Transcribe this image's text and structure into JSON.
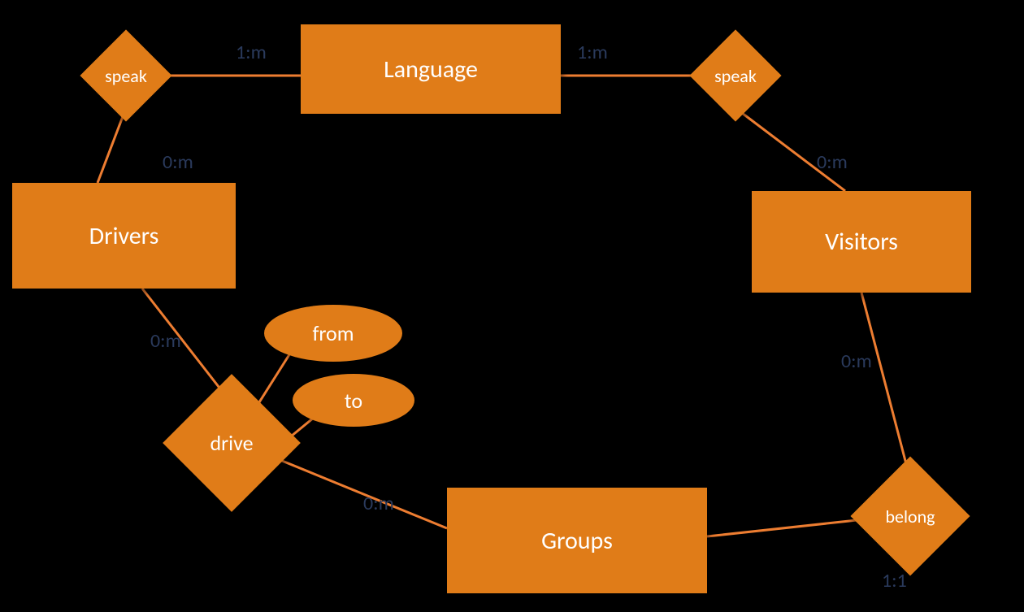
{
  "diagram": {
    "type": "entity-relationship",
    "entities": {
      "language": "Language",
      "drivers": "Drivers",
      "visitors": "Visitors",
      "groups": "Groups"
    },
    "relationships": {
      "speak_left": "speak",
      "speak_right": "speak",
      "drive": "drive",
      "belong": "belong"
    },
    "attributes": {
      "from": "from",
      "to": "to"
    },
    "cardinalities": {
      "lang_speak_left": "1:m",
      "lang_speak_right": "1:m",
      "drivers_speak": "0:m",
      "visitors_speak": "0:m",
      "drivers_drive": "0:m",
      "groups_drive": "0:m",
      "visitors_belong": "0:m",
      "groups_belong": "1:1"
    },
    "colors": {
      "shape_fill": "#E07C18",
      "shape_text": "#FFFFFF",
      "card_text": "#2A3A5C",
      "line": "#ED7D31",
      "background": "#000000"
    }
  }
}
